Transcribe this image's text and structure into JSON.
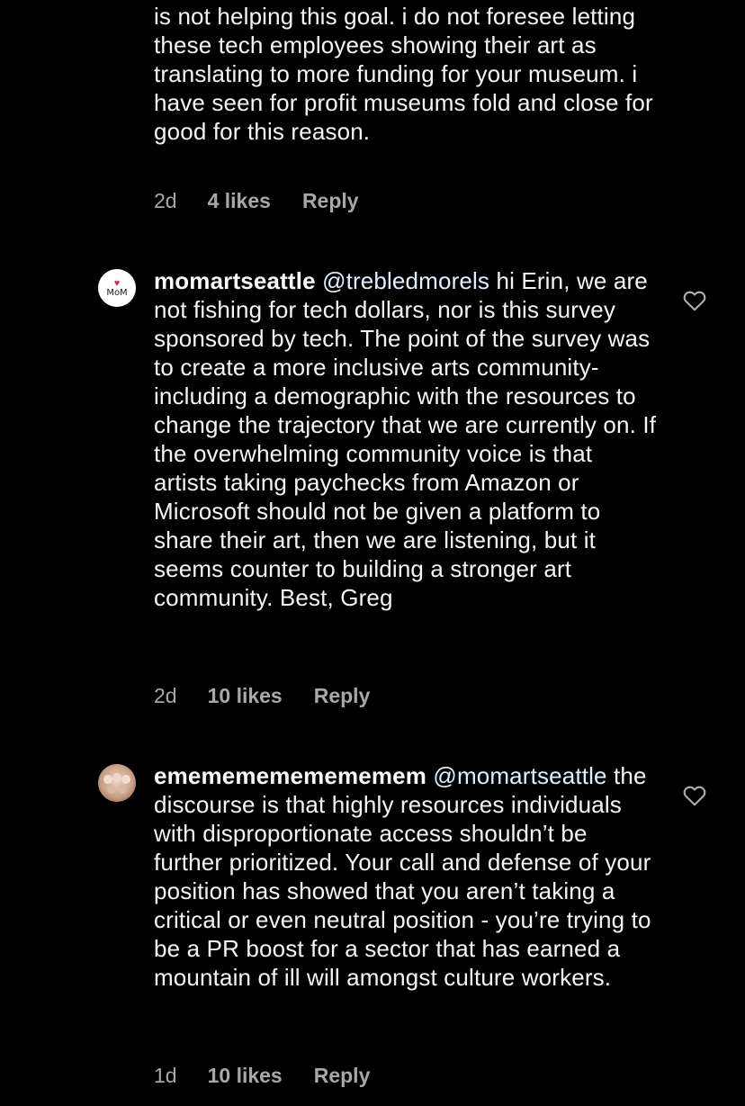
{
  "comments": [
    {
      "username": "",
      "mention": "",
      "text": "is not helping this goal. i do not foresee letting these tech employees showing their art as translating to more funding for your museum. i have seen for profit museums fold and close for good for this reason.",
      "time": "2d",
      "likes": "4 likes",
      "reply": "Reply"
    },
    {
      "username": "momartseattle",
      "mention": "@trebledmorels",
      "text": "hi Erin, we are not fishing for tech dollars, nor is this survey sponsored by tech. The point of the survey was to create a more inclusive arts community- including a demographic with the resources to change the trajectory that we are currently on. If the overwhelming community voice is that artists taking paychecks from Amazon or Microsoft should not be given a platform to share their art, then we are listening, but it seems counter to building a stronger art community. Best, Greg",
      "time": "2d",
      "likes": "10 likes",
      "reply": "Reply",
      "avatar_text": "MoM",
      "avatar_icon": "heart"
    },
    {
      "username": "emememememememem",
      "mention": "@momartseattle",
      "text": "the discourse is that highly resources individuals with disproportionate access shouldn’t be further prioritized. Your call and defense of your position has showed that you aren’t taking a critical or even neutral position - you’re trying to be a PR boost for a sector that has earned a mountain of ill will amongst culture workers.",
      "time": "1d",
      "likes": "10 likes",
      "reply": "Reply"
    }
  ],
  "icons": {
    "like": "heart-outline-icon"
  },
  "colors": {
    "background": "#000000",
    "text": "#f5f5f5",
    "meta": "#a8a8a8",
    "mention": "#e0f1ff",
    "avatar_heart": "#e0245e"
  }
}
